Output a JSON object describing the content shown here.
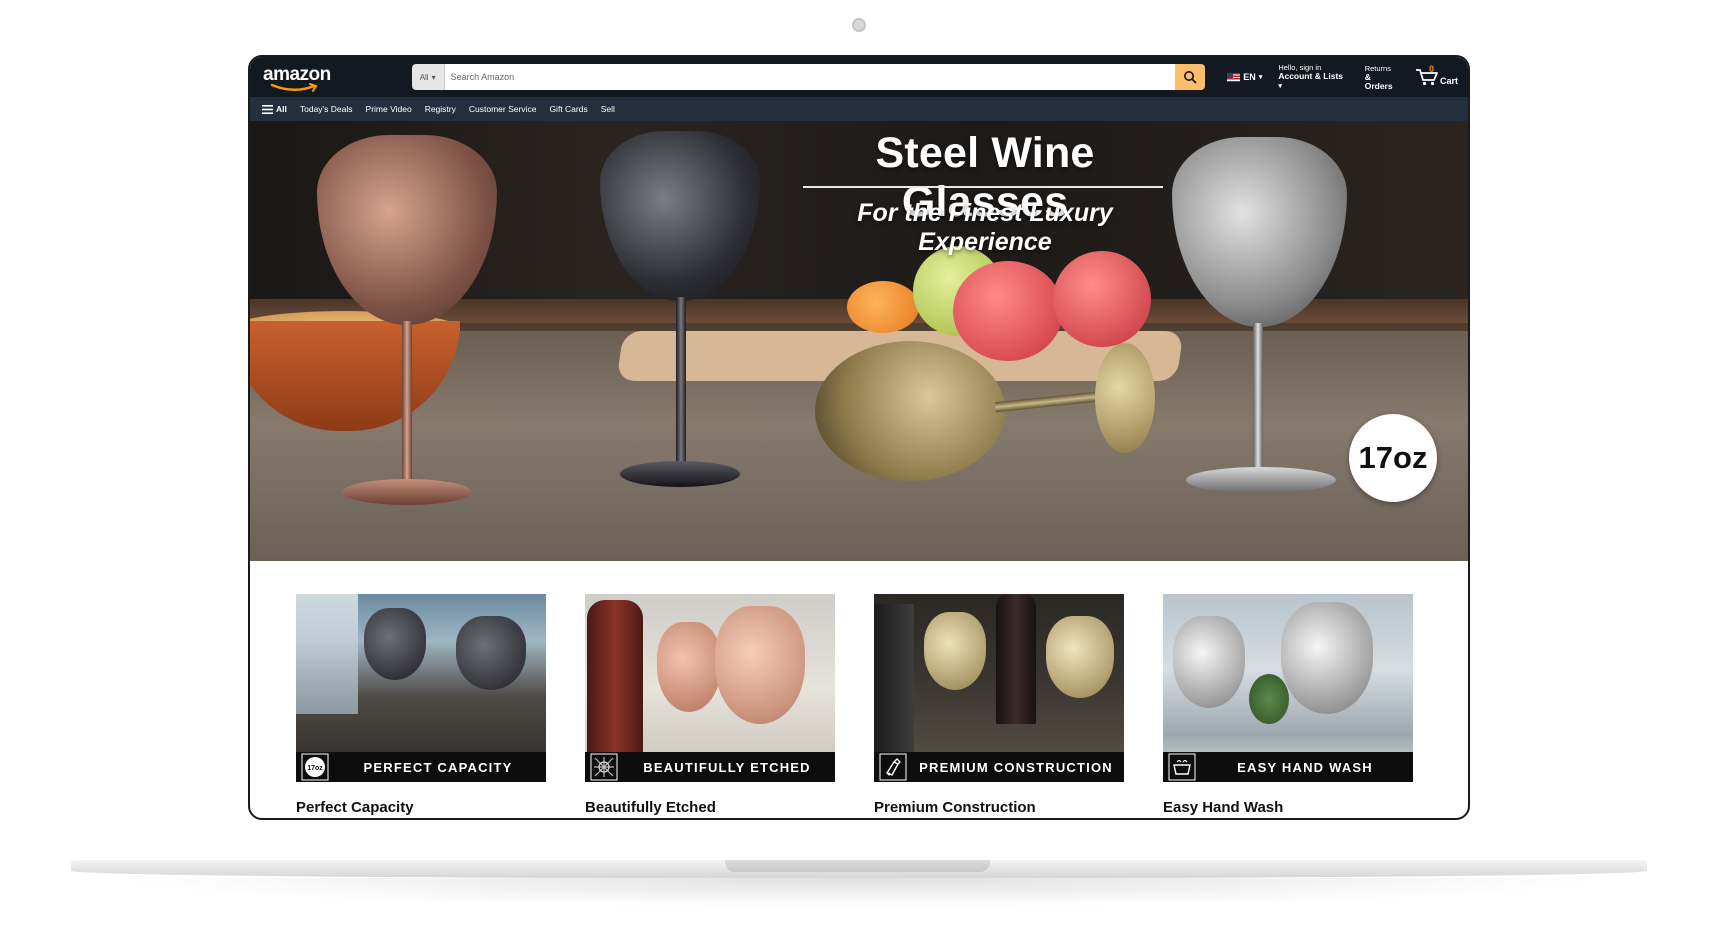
{
  "nav": {
    "logo_text": "amazon",
    "search_category": "All",
    "search_placeholder": "Search Amazon",
    "language": "EN",
    "account_line1": "Hello, sign in",
    "account_line2": "Account & Lists",
    "returns_line1": "Returns",
    "returns_line2": "& Orders",
    "cart_count": "0",
    "cart_label": "Cart"
  },
  "subnav": {
    "all_label": "All",
    "items": [
      "Today's Deals",
      "Prime Video",
      "Registry",
      "Customer Service",
      "Gift Cards",
      "Sell"
    ]
  },
  "hero": {
    "title": "Steel Wine Glasses",
    "subtitle": "For the Finest Luxury Experience",
    "badge": "17oz"
  },
  "features": [
    {
      "banner": "PERFECT CAPACITY",
      "title": "Perfect Capacity",
      "icon_text": "17oz",
      "icon": "capacity-icon"
    },
    {
      "banner": "BEAUTIFULLY ETCHED",
      "title": "Beautifully Etched",
      "icon": "etched-pattern-icon"
    },
    {
      "banner": "PREMIUM CONSTRUCTION",
      "title": "Premium Construction",
      "icon": "construction-icon"
    },
    {
      "banner": "EASY HAND WASH",
      "title": "Easy Hand Wash",
      "icon": "hand-wash-icon"
    }
  ],
  "colors": {
    "nav_bg": "#131921",
    "subnav_bg": "#232f3e",
    "search_button": "#febd69",
    "cart_count": "#f08804"
  }
}
